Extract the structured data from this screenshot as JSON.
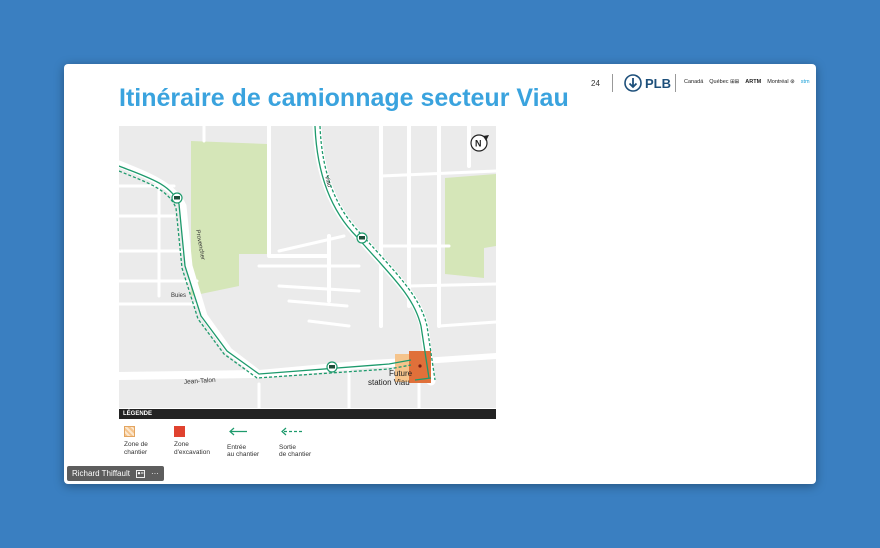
{
  "slide": {
    "title": "Itinéraire de camionnage secteur Viau",
    "page_number": "24",
    "logo_text": "PLB",
    "partners": [
      "Canadä",
      "Québec ⊞⊞",
      "ARTM",
      "Montréal ⊛",
      "stm"
    ]
  },
  "map": {
    "streets": {
      "viau": "Viau",
      "provencher": "Provencher",
      "buies": "Buies",
      "jean_talon": "Jean-Talon"
    },
    "site_label_line1": "Future",
    "site_label_line2": "station Viau",
    "north_label": "N",
    "colors": {
      "route": "#1d9a6c",
      "park": "#d5e6b8",
      "road": "#ffffff",
      "excavation": "#e0422f",
      "site": "#f5c48c"
    }
  },
  "legend": {
    "title": "LÉGENDE",
    "items": [
      {
        "line1": "Zone de",
        "line2": "chantier"
      },
      {
        "line1": "Zone",
        "line2": "d'excavation"
      },
      {
        "line1": "Entrée",
        "line2": "au chantier"
      },
      {
        "line1": "Sortie",
        "line2": "de chantier"
      }
    ]
  },
  "presenter": {
    "name": "Richard Thiffault",
    "more_icon": "more-icon"
  }
}
